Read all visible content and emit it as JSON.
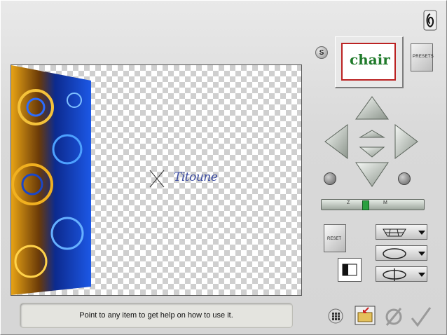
{
  "status_bar": {
    "help_text": "Point to any item to get help on how to use it."
  },
  "preview": {
    "watermark_text": "Titoune"
  },
  "controls": {
    "s_label": "S",
    "presets_label": "PRESETS",
    "preset_thumbnail_text": "chair",
    "reset_label": "RESET",
    "slider_ticks": "Z 0 M"
  },
  "colors": {
    "accent_green": "#2aa040",
    "thumbnail_border": "#b22222",
    "checker": "#cfcfcf"
  },
  "icons": {
    "corner": "twist-effect-icon",
    "grid": "grid-icon",
    "save": "save-folder-icon",
    "cancel": "cancel-icon",
    "ok": "check-icon"
  }
}
